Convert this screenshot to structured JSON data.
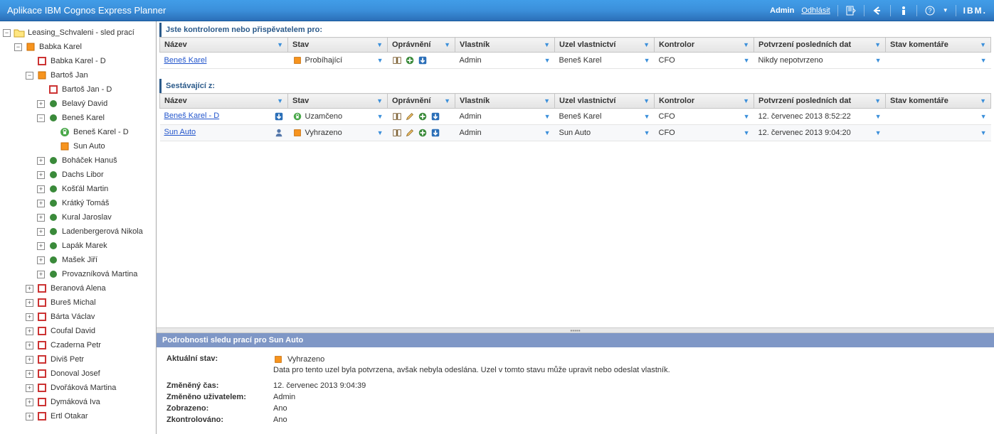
{
  "header": {
    "title": "Aplikace IBM Cognos Express Planner",
    "user": "Admin",
    "logout": "Odhlásit",
    "ibm": "IBM."
  },
  "tree": [
    {
      "indent": 0,
      "toggle": "minus",
      "icon": "folder",
      "label": "Leasing_Schvaleni - sled prací"
    },
    {
      "indent": 1,
      "toggle": "minus",
      "icon": "sq-orange",
      "label": "Babka Karel"
    },
    {
      "indent": 2,
      "toggle": "none",
      "icon": "sq-red",
      "label": "Babka Karel - D"
    },
    {
      "indent": 2,
      "toggle": "minus",
      "icon": "sq-orange",
      "label": "Bartoš Jan"
    },
    {
      "indent": 3,
      "toggle": "none",
      "icon": "sq-red",
      "label": "Bartoš Jan - D"
    },
    {
      "indent": 3,
      "toggle": "plus",
      "icon": "c-green",
      "label": "Belavý David"
    },
    {
      "indent": 3,
      "toggle": "minus",
      "icon": "c-green",
      "label": "Beneš Karel"
    },
    {
      "indent": 4,
      "toggle": "none",
      "icon": "c-lock",
      "label": "Beneš Karel - D"
    },
    {
      "indent": 4,
      "toggle": "none",
      "icon": "sq-orange",
      "label": "Sun Auto"
    },
    {
      "indent": 3,
      "toggle": "plus",
      "icon": "c-green",
      "label": "Boháček Hanuš"
    },
    {
      "indent": 3,
      "toggle": "plus",
      "icon": "c-green",
      "label": "Dachs Libor"
    },
    {
      "indent": 3,
      "toggle": "plus",
      "icon": "c-green",
      "label": "Košťál Martin"
    },
    {
      "indent": 3,
      "toggle": "plus",
      "icon": "c-green",
      "label": "Krátký Tomáš"
    },
    {
      "indent": 3,
      "toggle": "plus",
      "icon": "c-green",
      "label": "Kural Jaroslav"
    },
    {
      "indent": 3,
      "toggle": "plus",
      "icon": "c-green",
      "label": "Ladenbergerová Nikola"
    },
    {
      "indent": 3,
      "toggle": "plus",
      "icon": "c-green",
      "label": "Lapák Marek"
    },
    {
      "indent": 3,
      "toggle": "plus",
      "icon": "c-green",
      "label": "Mašek Jiří"
    },
    {
      "indent": 3,
      "toggle": "plus",
      "icon": "c-green",
      "label": "Provazníková Martina"
    },
    {
      "indent": 2,
      "toggle": "plus",
      "icon": "sq-red",
      "label": "Beranová Alena"
    },
    {
      "indent": 2,
      "toggle": "plus",
      "icon": "sq-red",
      "label": "Bureš Michal"
    },
    {
      "indent": 2,
      "toggle": "plus",
      "icon": "sq-red",
      "label": "Bárta Václav"
    },
    {
      "indent": 2,
      "toggle": "plus",
      "icon": "sq-red",
      "label": "Coufal David"
    },
    {
      "indent": 2,
      "toggle": "plus",
      "icon": "sq-red",
      "label": "Czaderna Petr"
    },
    {
      "indent": 2,
      "toggle": "plus",
      "icon": "sq-red",
      "label": "Diviš Petr"
    },
    {
      "indent": 2,
      "toggle": "plus",
      "icon": "sq-red",
      "label": "Donoval Josef"
    },
    {
      "indent": 2,
      "toggle": "plus",
      "icon": "sq-red",
      "label": "Dvořáková Martina"
    },
    {
      "indent": 2,
      "toggle": "plus",
      "icon": "sq-red",
      "label": "Dymáková Iva"
    },
    {
      "indent": 2,
      "toggle": "plus",
      "icon": "sq-red",
      "label": "Ertl Otakar"
    }
  ],
  "sections": {
    "top_title": "Jste kontrolorem nebo přispěvatelem pro:",
    "bottom_title": "Sestávající z:"
  },
  "columns": {
    "nazev": "Název",
    "stav": "Stav",
    "opravneni": "Oprávnění",
    "vlastnik": "Vlastník",
    "uzel": "Uzel vlastnictví",
    "kontrolor": "Kontrolor",
    "potvrzeni": "Potvrzení posledních dat",
    "stavkom": "Stav komentáře"
  },
  "table1": [
    {
      "nazev": "Beneš Karel",
      "navic": "",
      "stav_icon": "sq-orange",
      "stav": "Probíhající",
      "opr": [
        "book",
        "add",
        "down"
      ],
      "vlastnik": "Admin",
      "uzel": "Beneš Karel",
      "kontrolor": "CFO",
      "potvrzeni": "Nikdy nepotvrzeno"
    }
  ],
  "table2": [
    {
      "nazev": "Beneš Karel - D",
      "navic": "down",
      "stav_icon": "c-lock",
      "stav": "Uzamčeno",
      "opr": [
        "book",
        "edit",
        "add",
        "down"
      ],
      "vlastnik": "Admin",
      "uzel": "Beneš Karel",
      "kontrolor": "CFO",
      "potvrzeni": "12. červenec 2013 8:52:22"
    },
    {
      "nazev": "Sun Auto",
      "navic": "person",
      "stav_icon": "sq-orange",
      "stav": "Vyhrazeno",
      "opr": [
        "book",
        "edit",
        "add",
        "down"
      ],
      "vlastnik": "Admin",
      "uzel": "Sun Auto",
      "kontrolor": "CFO",
      "potvrzeni": "12. červenec 2013 9:04:20"
    }
  ],
  "details": {
    "title": "Podrobnosti sledu prací pro Sun Auto",
    "status_label": "Aktuální stav:",
    "status_icon": "sq-orange",
    "status_value": "Vyhrazeno",
    "status_desc": "Data pro tento uzel byla potvrzena, avšak nebyla odeslána. Uzel v tomto stavu může upravit nebo odeslat vlastník.",
    "rows": [
      {
        "label": "Změněný čas:",
        "value": "12. červenec 2013 9:04:39"
      },
      {
        "label": "Změněno uživatelem:",
        "value": "Admin"
      },
      {
        "label": "Zobrazeno:",
        "value": "Ano"
      },
      {
        "label": "Zkontrolováno:",
        "value": "Ano"
      }
    ]
  }
}
